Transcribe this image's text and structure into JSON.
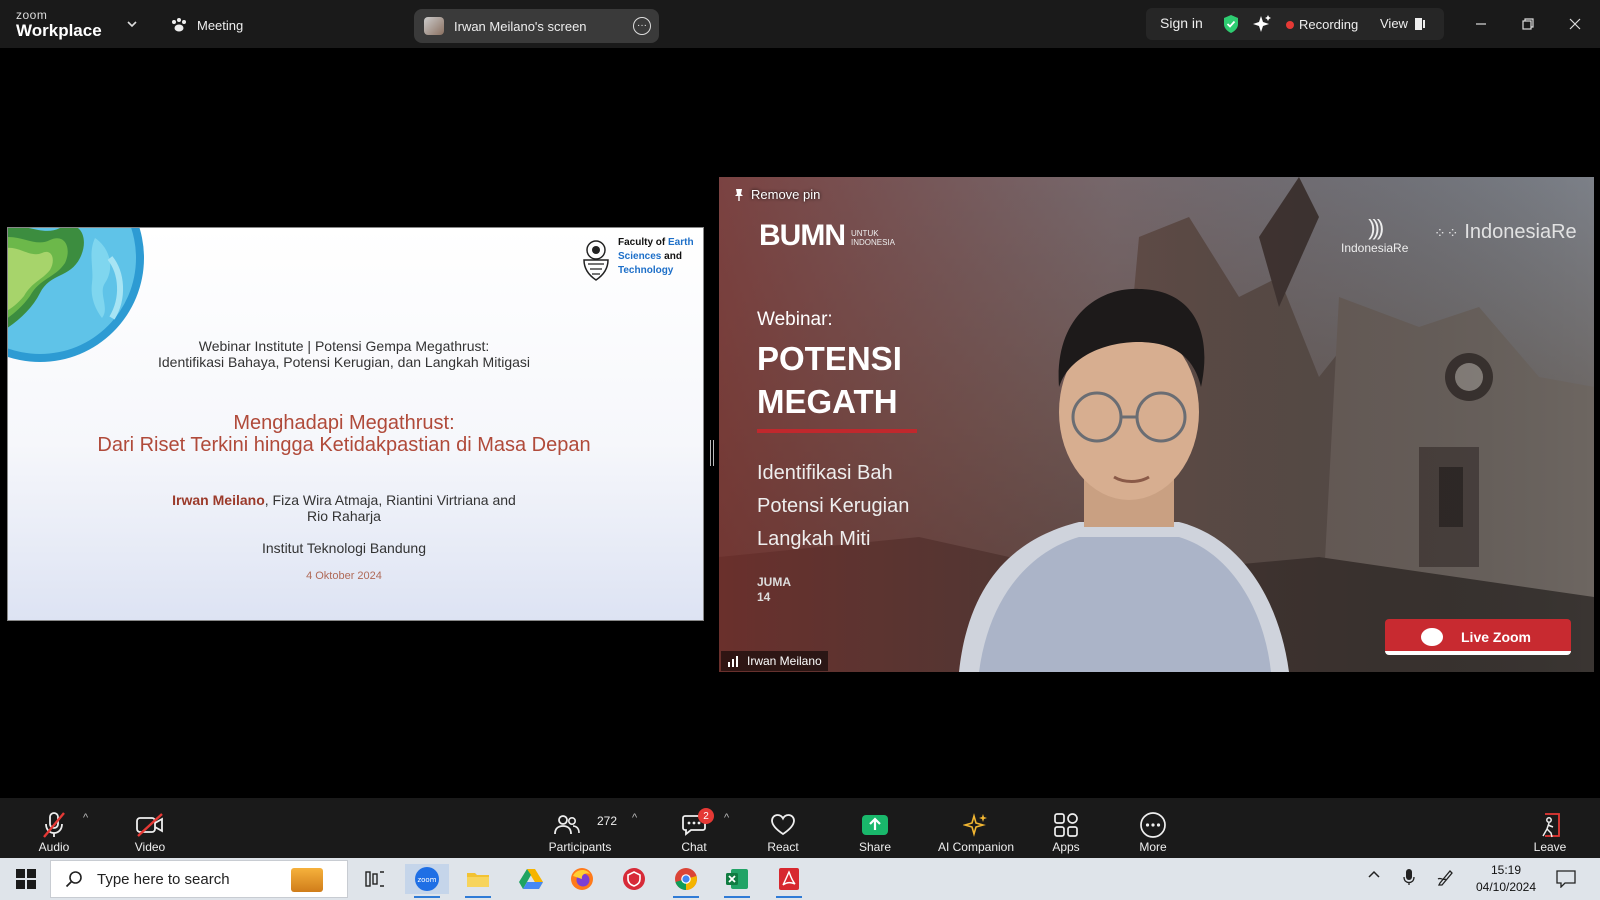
{
  "app": {
    "brand_small": "zoom",
    "brand_big": "Workplace",
    "meeting_label": "Meeting",
    "screen_share_label": "Irwan Meilano's screen"
  },
  "topbar": {
    "sign_in": "Sign in",
    "recording": "Recording",
    "view": "View"
  },
  "slide": {
    "subtitle_line1": "Webinar Institute | Potensi Gempa Megathrust:",
    "subtitle_line2": "Identifikasi Bahaya, Potensi Kerugian, dan Langkah Mitigasi",
    "title_line1": "Menghadapi Megathrust:",
    "title_line2": "Dari Riset Terkini hingga Ketidakpastian di Masa Depan",
    "author_lead": "Irwan Meilano",
    "authors_rest_line1": ", Fiza Wira Atmaja, Riantini Virtriana and",
    "authors_rest_line2": "Rio Raharja",
    "institution": "Institut Teknologi Bandung",
    "date": "4 Oktober 2024",
    "faculty_line1_black": "Faculty of ",
    "faculty_line1_blue": "Earth",
    "faculty_line2_blue": "Sciences",
    "faculty_line2_black": " and",
    "faculty_line3_blue": "Technology"
  },
  "video": {
    "remove_pin": "Remove pin",
    "bumn": "BUMN",
    "bumn_sub_1": "UNTUK",
    "bumn_sub_2": "INDONESIA",
    "indonesiare_small": "IndonesiaRe",
    "indonesiare_big": "IndonesiaRe",
    "webinar_label": "Webinar:",
    "title_line1": "POTENSI",
    "title_line2": "MEGATH",
    "desc_line1": "Identifikasi Bah",
    "desc_line2": "Potensi Kerugian",
    "desc_line3": "Langkah Miti",
    "date_line1": "JUMA",
    "date_line2": "14",
    "live_zoom": "Live Zoom",
    "participant_name": "Irwan Meilano"
  },
  "toolbar": {
    "audio": "Audio",
    "video": "Video",
    "participants": "Participants",
    "participants_count": "272",
    "chat": "Chat",
    "chat_badge": "2",
    "react": "React",
    "share": "Share",
    "ai_companion": "AI Companion",
    "apps": "Apps",
    "more": "More",
    "leave": "Leave"
  },
  "taskbar": {
    "search_placeholder": "Type here to search",
    "time": "15:19",
    "date": "04/10/2024"
  },
  "colors": {
    "recording": "#e53935",
    "share_green": "#19b86b",
    "ai_gold": "#f2b632",
    "leave_red": "#e53935",
    "shield_green": "#2ecc71"
  }
}
